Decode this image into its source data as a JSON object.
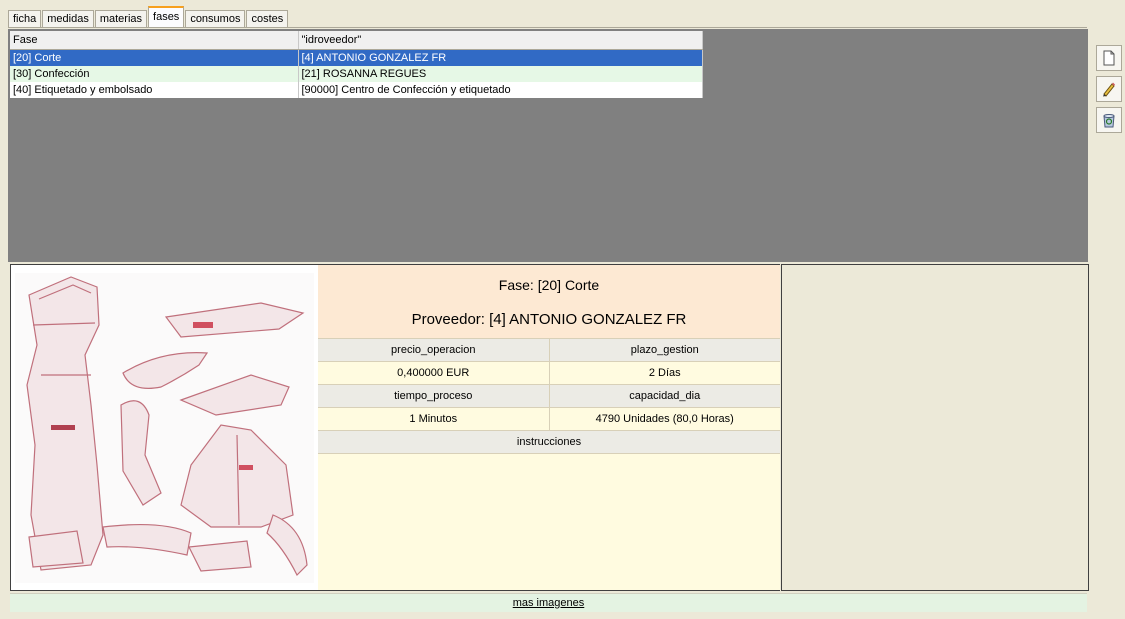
{
  "tabs": [
    {
      "label": "ficha"
    },
    {
      "label": "medidas"
    },
    {
      "label": "materias"
    },
    {
      "label": "fases",
      "active": true
    },
    {
      "label": "consumos"
    },
    {
      "label": "costes"
    }
  ],
  "grid": {
    "headers": [
      "Fase",
      "\"idroveedor\""
    ],
    "rows": [
      {
        "fase": "[20] Corte",
        "proveedor": "[4] ANTONIO GONZALEZ FR",
        "selected": true
      },
      {
        "fase": "[30] Confección",
        "proveedor": "[21] ROSANNA  REGUES"
      },
      {
        "fase": "[40] Etiquetado y embolsado",
        "proveedor": "[90000] Centro de Confección y etiquetado"
      }
    ]
  },
  "toolbar": {
    "new_icon": "new-document-icon",
    "edit_icon": "pencil-icon",
    "delete_icon": "recycle-bin-icon"
  },
  "detail": {
    "fase_title": "Fase: [20] Corte",
    "proveedor_title": "Proveedor: [4] ANTONIO GONZALEZ FR",
    "labels": {
      "precio_operacion": "precio_operacion",
      "plazo_gestion": "plazo_gestion",
      "tiempo_proceso": "tiempo_proceso",
      "capacidad_dia": "capacidad_dia",
      "instrucciones": "instrucciones"
    },
    "values": {
      "precio_operacion": "0,400000 EUR",
      "plazo_gestion": "2 Días",
      "tiempo_proceso": "1 Minutos",
      "capacidad_dia": "4790 Unidades (80,0 Horas)",
      "instrucciones": ""
    }
  },
  "footer": {
    "more_images": "mas imagenes"
  },
  "colors": {
    "selection": "#316ac5",
    "active_tab_accent": "#f7a01c",
    "header_bg": "#fde9d3",
    "detail_bg": "#fffbe0"
  }
}
